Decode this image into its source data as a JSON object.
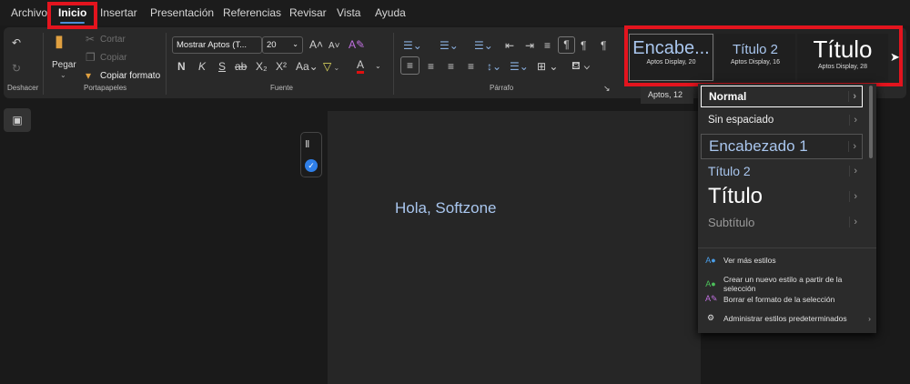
{
  "menu": {
    "tabs": [
      "Archivo",
      "Inicio",
      "Insertar",
      "Presentación",
      "Referencias",
      "Revisar",
      "Vista",
      "Ayuda"
    ],
    "active": "Inicio"
  },
  "ribbon": {
    "undo": {
      "group": "Deshacer"
    },
    "clipboard": {
      "paste": "Pegar",
      "cut": "Cortar",
      "copy": "Copiar",
      "format_painter": "Copiar formato",
      "group": "Portapapeles"
    },
    "font": {
      "name": "Mostrar Aptos (T...",
      "size": "20",
      "group": "Fuente",
      "bold": "N",
      "italic": "K",
      "underline": "S",
      "strike": "ab"
    },
    "paragraph": {
      "group": "Párrafo"
    },
    "styles": [
      {
        "name": "Encabe...",
        "font": "Aptos Display, 20"
      },
      {
        "name": "Título 2",
        "font": "Aptos Display, 16"
      },
      {
        "name": "Título",
        "font": "Aptos Display, 28"
      }
    ]
  },
  "tooltip": "Aptos, 12",
  "document": {
    "text": "Hola, Softzone"
  },
  "dropdown": {
    "styles": [
      "Normal",
      "Sin espaciado",
      "Encabezado 1",
      "Título 2",
      "Título",
      "Subtítulo"
    ],
    "actions": [
      "Ver más estilos",
      "Crear un nuevo estilo a partir de la selección",
      "Borrar el formato de la selección",
      "Administrar estilos predeterminados"
    ]
  },
  "colors": {
    "highlight_red": "#e3141e",
    "accent_blue": "#4a8ed8",
    "heading_blue": "#a9c6ee"
  }
}
